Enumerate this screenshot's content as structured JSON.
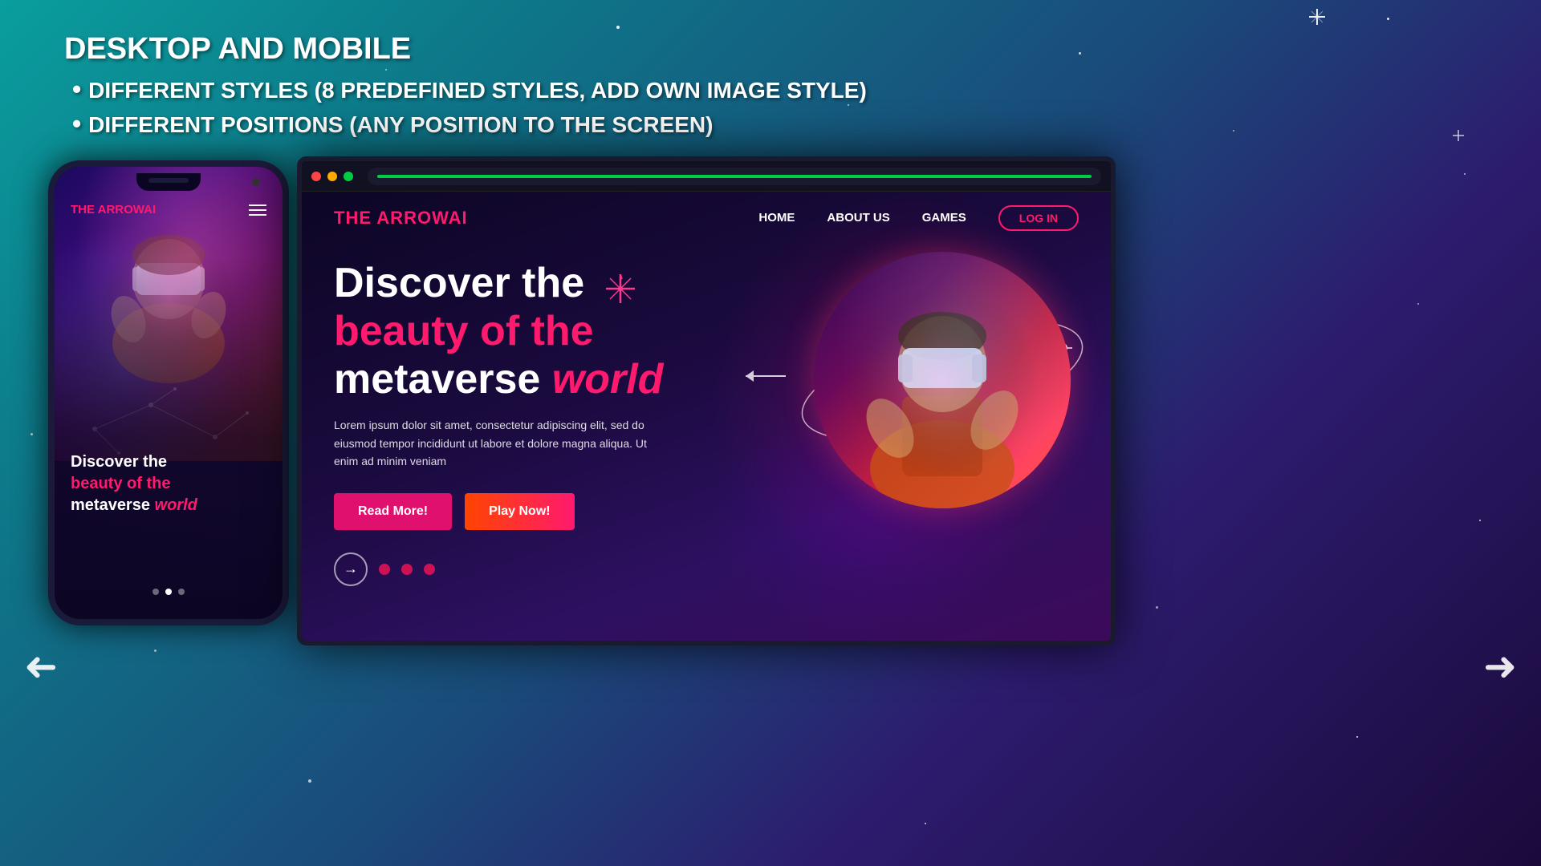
{
  "background": {
    "gradient_start": "#0a9e9e",
    "gradient_end": "#1a0a3a"
  },
  "header": {
    "title": "DESKTOP AND MOBILE",
    "bullets": [
      "DIFFERENT STYLES (8 PREDEFINED STYLES, ADD OWN IMAGE STYLE)",
      "DIFFERENT POSITIONS (ANY POSITION TO THE SCREEN)"
    ]
  },
  "phone": {
    "logo": "THE ARROWAI",
    "hero_line1": "Discover the",
    "hero_line2": "beauty of the",
    "hero_line3": "metaverse",
    "hero_world": "world"
  },
  "desktop": {
    "logo": "THE ARROWAI",
    "nav": {
      "links": [
        "HOME",
        "ABOUT US",
        "GAMES"
      ],
      "login_label": "LOG IN"
    },
    "hero": {
      "title_line1": "Discover the",
      "title_line2": "beauty of the",
      "title_line3": "metaverse",
      "title_world": "world",
      "description": "Lorem ipsum dolor sit amet, consectetur adipiscing elit, sed do eiusmod tempor incididunt ut labore et dolore magna aliqua. Ut enim ad minim veniam",
      "btn_read_more": "Read More!",
      "btn_play_now": "Play Now!"
    }
  },
  "arrows": {
    "left": "←",
    "right": "→"
  }
}
